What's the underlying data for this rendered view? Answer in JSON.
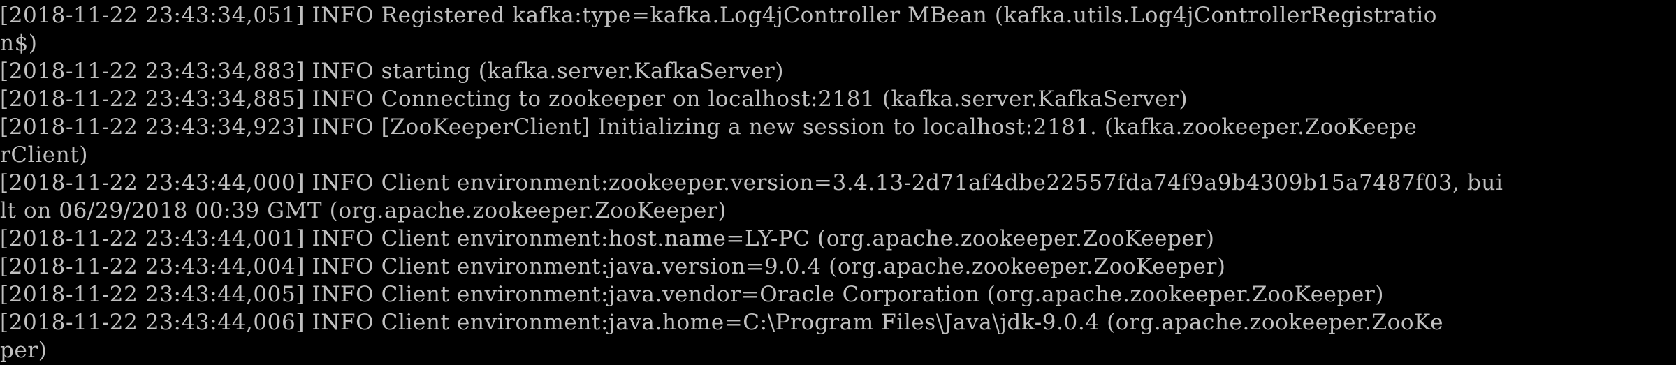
{
  "terminal": {
    "lines": [
      "[2018-11-22 23:43:34,051] INFO Registered kafka:type=kafka.Log4jController MBean (kafka.utils.Log4jControllerRegistratio",
      "n$)",
      "[2018-11-22 23:43:34,883] INFO starting (kafka.server.KafkaServer)",
      "[2018-11-22 23:43:34,885] INFO Connecting to zookeeper on localhost:2181 (kafka.server.KafkaServer)",
      "[2018-11-22 23:43:34,923] INFO [ZooKeeperClient] Initializing a new session to localhost:2181. (kafka.zookeeper.ZooKeepe",
      "rClient)",
      "[2018-11-22 23:43:44,000] INFO Client environment:zookeeper.version=3.4.13-2d71af4dbe22557fda74f9a9b4309b15a7487f03, bui",
      "lt on 06/29/2018 00:39 GMT (org.apache.zookeeper.ZooKeeper)",
      "[2018-11-22 23:43:44,001] INFO Client environment:host.name=LY-PC (org.apache.zookeeper.ZooKeeper)",
      "[2018-11-22 23:43:44,004] INFO Client environment:java.version=9.0.4 (org.apache.zookeeper.ZooKeeper)",
      "[2018-11-22 23:43:44,005] INFO Client environment:java.vendor=Oracle Corporation (org.apache.zookeeper.ZooKeeper)",
      "[2018-11-22 23:43:44,006] INFO Client environment:java.home=C:\\Program Files\\Java\\jdk-9.0.4 (org.apache.zookeeper.ZooKe",
      "per)"
    ]
  },
  "colors": {
    "background": "#000000",
    "text": "#C0C0C0"
  }
}
